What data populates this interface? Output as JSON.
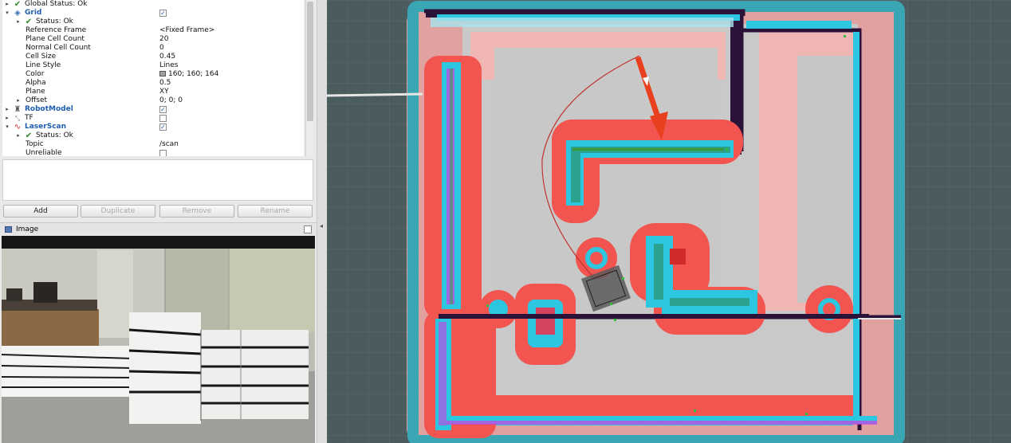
{
  "displays": {
    "rows": [
      {
        "name": "Global Status: Ok",
        "value": ""
      },
      {
        "name": "Grid",
        "value": "✓"
      },
      {
        "name": "Status: Ok",
        "value": ""
      },
      {
        "name": "Reference Frame",
        "value": "<Fixed Frame>"
      },
      {
        "name": "Plane Cell Count",
        "value": "20"
      },
      {
        "name": "Normal Cell Count",
        "value": "0"
      },
      {
        "name": "Cell Size",
        "value": "0.45"
      },
      {
        "name": "Line Style",
        "value": "Lines"
      },
      {
        "name": "Color",
        "value": "160; 160; 164"
      },
      {
        "name": "Alpha",
        "value": "0.5"
      },
      {
        "name": "Plane",
        "value": "XY"
      },
      {
        "name": "Offset",
        "value": "0; 0; 0"
      },
      {
        "name": "RobotModel",
        "value": "✓"
      },
      {
        "name": "TF",
        "value": ""
      },
      {
        "name": "LaserScan",
        "value": "✓"
      },
      {
        "name": "Status: Ok",
        "value": ""
      },
      {
        "name": "Topic",
        "value": "/scan"
      },
      {
        "name": "Unreliable",
        "value": ""
      }
    ]
  },
  "buttons": {
    "add": "Add",
    "duplicate": "Duplicate",
    "remove": "Remove",
    "rename": "Rename"
  },
  "image_panel": {
    "title": "Image"
  },
  "colors": {
    "grid": "#a0a0a4",
    "inflation_red": "#f25550",
    "inflation_pink": "#f2a8a8",
    "costmap_cyan": "#2cc6e0",
    "obstacle_magenta": "#d23ce0",
    "wall_dark": "#2a1238",
    "path": "#c0302a",
    "goal_arrow": "#e8401e"
  },
  "icons": {
    "status_ok": "check-icon",
    "grid": "grid-icon",
    "robot_model": "robot-icon",
    "tf": "tf-icon",
    "laser_scan": "laserscan-icon",
    "image": "image-icon"
  }
}
